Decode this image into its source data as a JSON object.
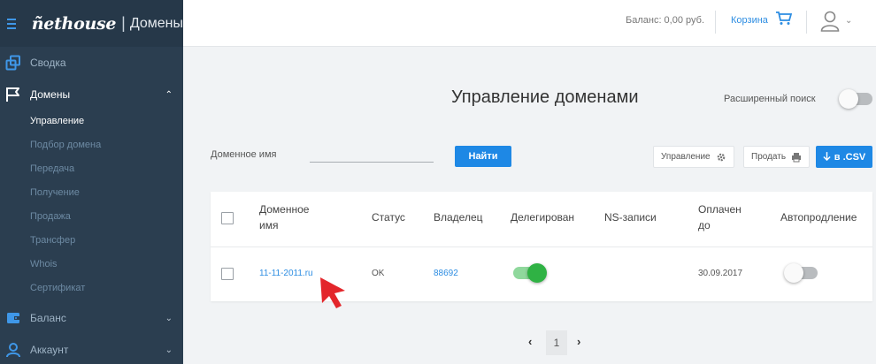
{
  "app": {
    "logo": "ñethouse",
    "section": "Домены"
  },
  "sidebar": {
    "items": [
      {
        "label": "Сводка"
      },
      {
        "label": "Домены"
      },
      {
        "label": "Баланс"
      },
      {
        "label": "Аккаунт"
      }
    ],
    "domains_sub": [
      "Управление",
      "Подбор домена",
      "Передача",
      "Получение",
      "Продажа",
      "Трансфер",
      "Whois",
      "Сертификат"
    ]
  },
  "topbar": {
    "balance": "Баланс: 0,00 руб.",
    "cart": "Корзина"
  },
  "main": {
    "title": "Управление доменами",
    "advanced_search": "Расширенный поиск",
    "domain_label": "Доменное имя",
    "domain_value": "",
    "find_button": "Найти",
    "manage_button": "Управление",
    "sell_button": "Продать",
    "csv_button": "в .CSV"
  },
  "table": {
    "headers": {
      "domain_1": "Доменное",
      "domain_2": "имя",
      "status": "Статус",
      "owner": "Владелец",
      "delegated": "Делегирован",
      "ns": "NS-записи",
      "paid_1": "Оплачен",
      "paid_2": "до",
      "autorenew": "Автопродление"
    },
    "rows": [
      {
        "domain": "11-11-2011.ru",
        "status": "OK",
        "owner": "88692",
        "delegated": true,
        "ns": "",
        "paid_until": "30.09.2017",
        "autorenew": false
      }
    ]
  },
  "pagination": {
    "prev": "‹",
    "current": "1",
    "next": "›"
  },
  "colors": {
    "sidebar_bg": "#2b3e50",
    "accent": "#1e88e5",
    "link": "#2d8de2",
    "toggle_on": "#2fb244",
    "cursor": "#e3262b"
  }
}
